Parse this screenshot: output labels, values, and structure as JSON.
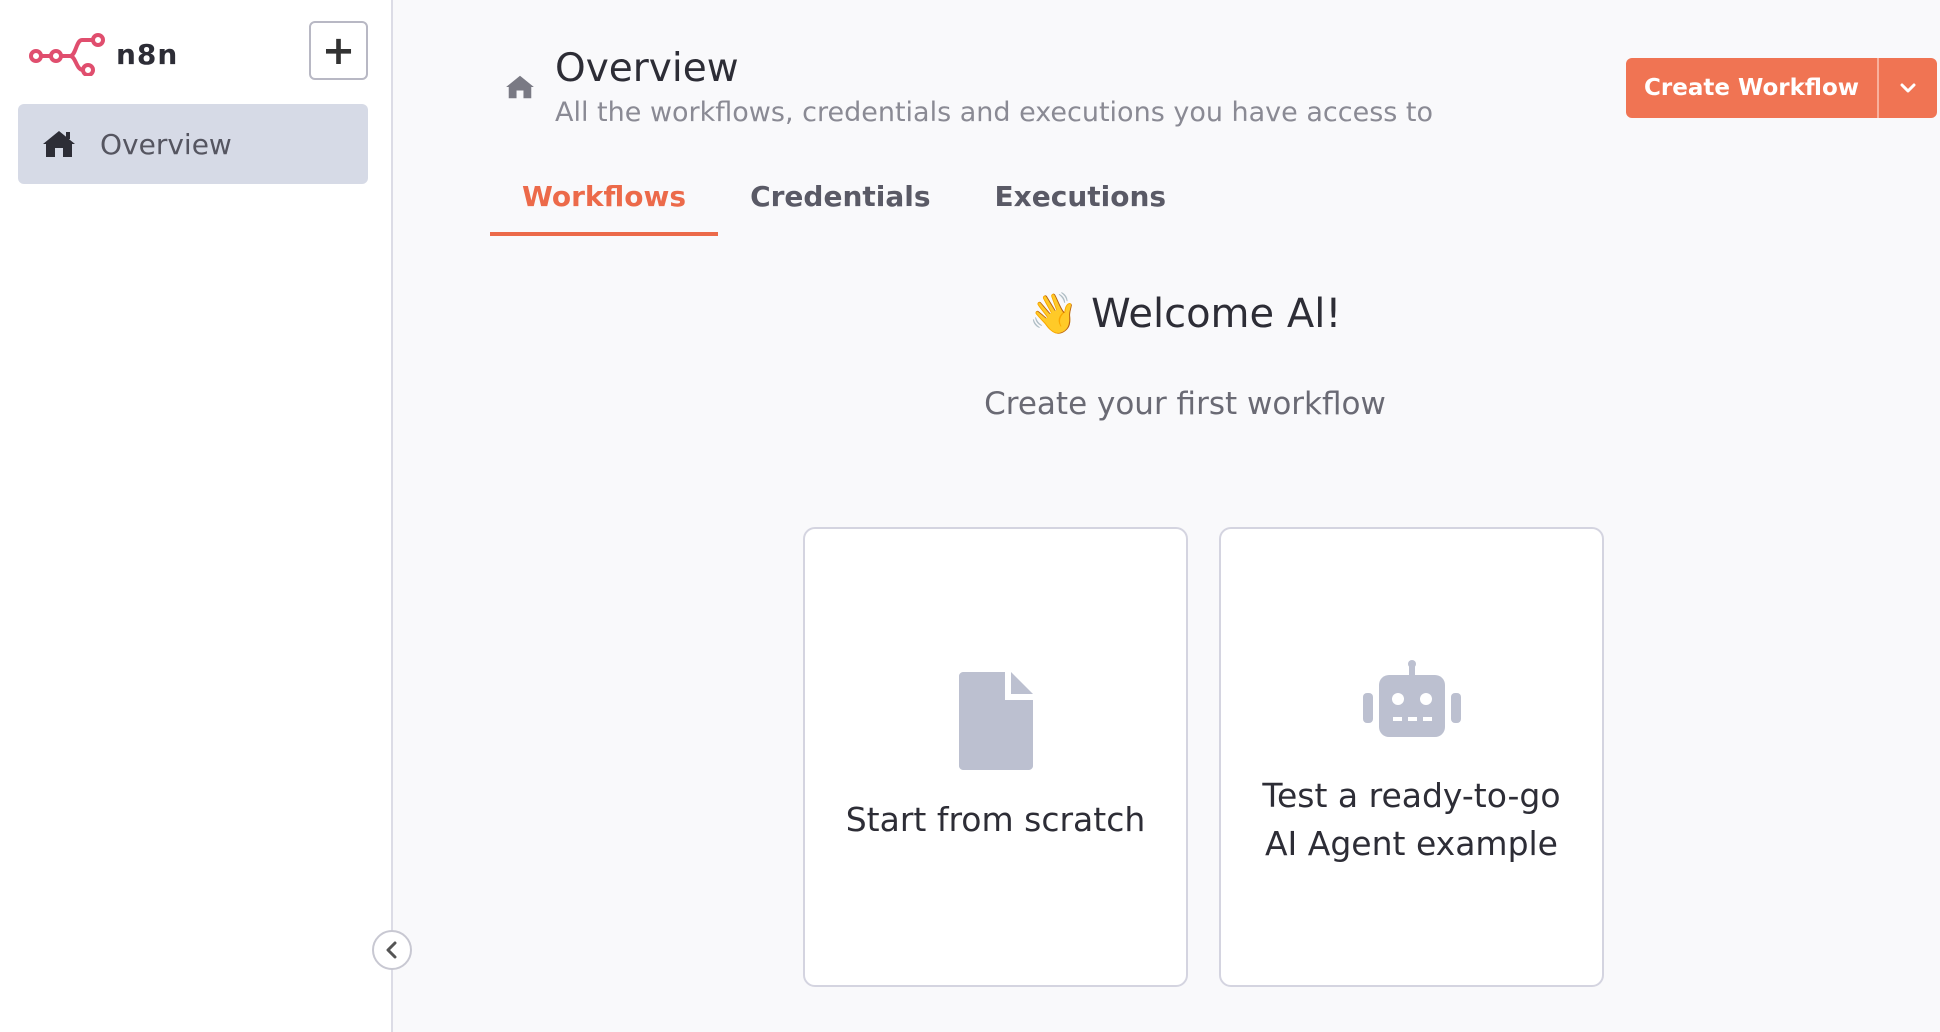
{
  "sidebar": {
    "logo_text": "n8n",
    "add_label": "+",
    "items": [
      {
        "label": "Overview",
        "icon": "home-icon",
        "active": true
      }
    ]
  },
  "header": {
    "title": "Overview",
    "subtitle": "All the workflows, credentials and executions you have access to",
    "create_button_label": "Create Workflow"
  },
  "tabs": [
    {
      "label": "Workflows",
      "active": true
    },
    {
      "label": "Credentials",
      "active": false
    },
    {
      "label": "Executions",
      "active": false
    }
  ],
  "welcome": {
    "emoji": "👋",
    "heading": "Welcome Al!",
    "subheading": "Create your first workflow"
  },
  "cards": [
    {
      "label": "Start from scratch",
      "icon": "file-icon"
    },
    {
      "label_line1": "Test a ready-to-go",
      "label_line2": "AI Agent example",
      "icon": "robot-icon"
    }
  ],
  "colors": {
    "accent": "#ec6a4a",
    "button": "#f07453",
    "logo": "#e04e6e",
    "nav_active_bg": "#d6dae6",
    "icon_gray": "#bcc0d0"
  }
}
